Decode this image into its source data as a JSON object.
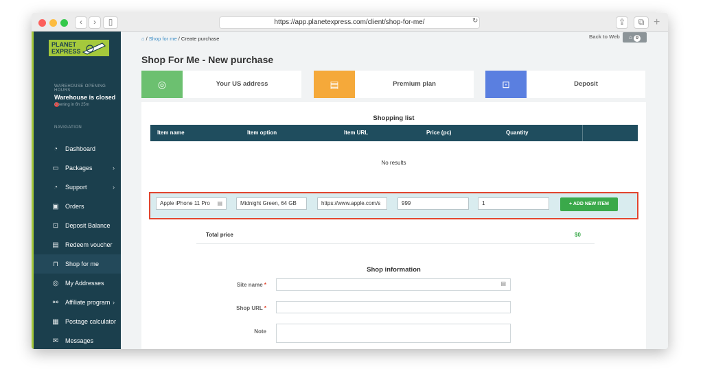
{
  "browser": {
    "url": "https://app.planetexpress.com/client/shop-for-me/",
    "colors": {
      "close": "#fc605c",
      "minimize": "#fdbc40",
      "zoom": "#34c84a"
    }
  },
  "sidebar": {
    "logo_line1": "PLANET",
    "logo_line2": "EXPRESS",
    "hours_heading": "WAREHOUSE OPENING HOURS",
    "status": "Warehouse is closed",
    "opening": "Opening in 6h 25m",
    "nav_heading": "NAVIGATION",
    "items": [
      {
        "label": "Dashboard",
        "icon": "dashboard-icon"
      },
      {
        "label": "Packages",
        "icon": "package-icon"
      },
      {
        "label": "Support",
        "icon": "support-icon"
      },
      {
        "label": "Orders",
        "icon": "orders-icon"
      },
      {
        "label": "Deposit Balance",
        "icon": "deposit-icon"
      },
      {
        "label": "Redeem voucher",
        "icon": "voucher-icon"
      },
      {
        "label": "Shop for me",
        "icon": "shopping-bag-icon"
      },
      {
        "label": "My Addresses",
        "icon": "location-pin-icon"
      },
      {
        "label": "Affiliate program",
        "icon": "affiliate-icon"
      },
      {
        "label": "Postage calculator",
        "icon": "calculator-icon"
      },
      {
        "label": "Messages",
        "icon": "mail-icon"
      }
    ]
  },
  "header": {
    "crumb_shop": "Shop for me",
    "crumb_current": "Create purchase",
    "back_label": "Back to Web",
    "badge": "0"
  },
  "page": {
    "title": "Shop For Me - New purchase",
    "cards": [
      {
        "label": "Your US address",
        "color": "#6cc070",
        "icon": "location-pin-icon"
      },
      {
        "label": "Premium plan",
        "color": "#f5a93a",
        "icon": "clipboard-icon"
      },
      {
        "label": "Deposit",
        "color": "#5a7fe0",
        "icon": "deposit-icon"
      }
    ]
  },
  "shopping_list": {
    "heading": "Shopping list",
    "columns": [
      "Item name",
      "Item option",
      "Item URL",
      "Price (pc)",
      "Quantity"
    ],
    "empty": "No results",
    "new_item": {
      "name": "Apple iPhone 11 Pro",
      "option": "Midnight Green, 64 GB",
      "url": "https://www.apple.com/s",
      "price": "999",
      "quantity": "1"
    },
    "add_button": "+ ADD NEW ITEM",
    "total_label": "Total price",
    "total_value": "$0"
  },
  "shop_info": {
    "heading": "Shop information",
    "site_name": "Site name",
    "shop_url": "Shop URL",
    "note": "Note",
    "required": "*"
  }
}
